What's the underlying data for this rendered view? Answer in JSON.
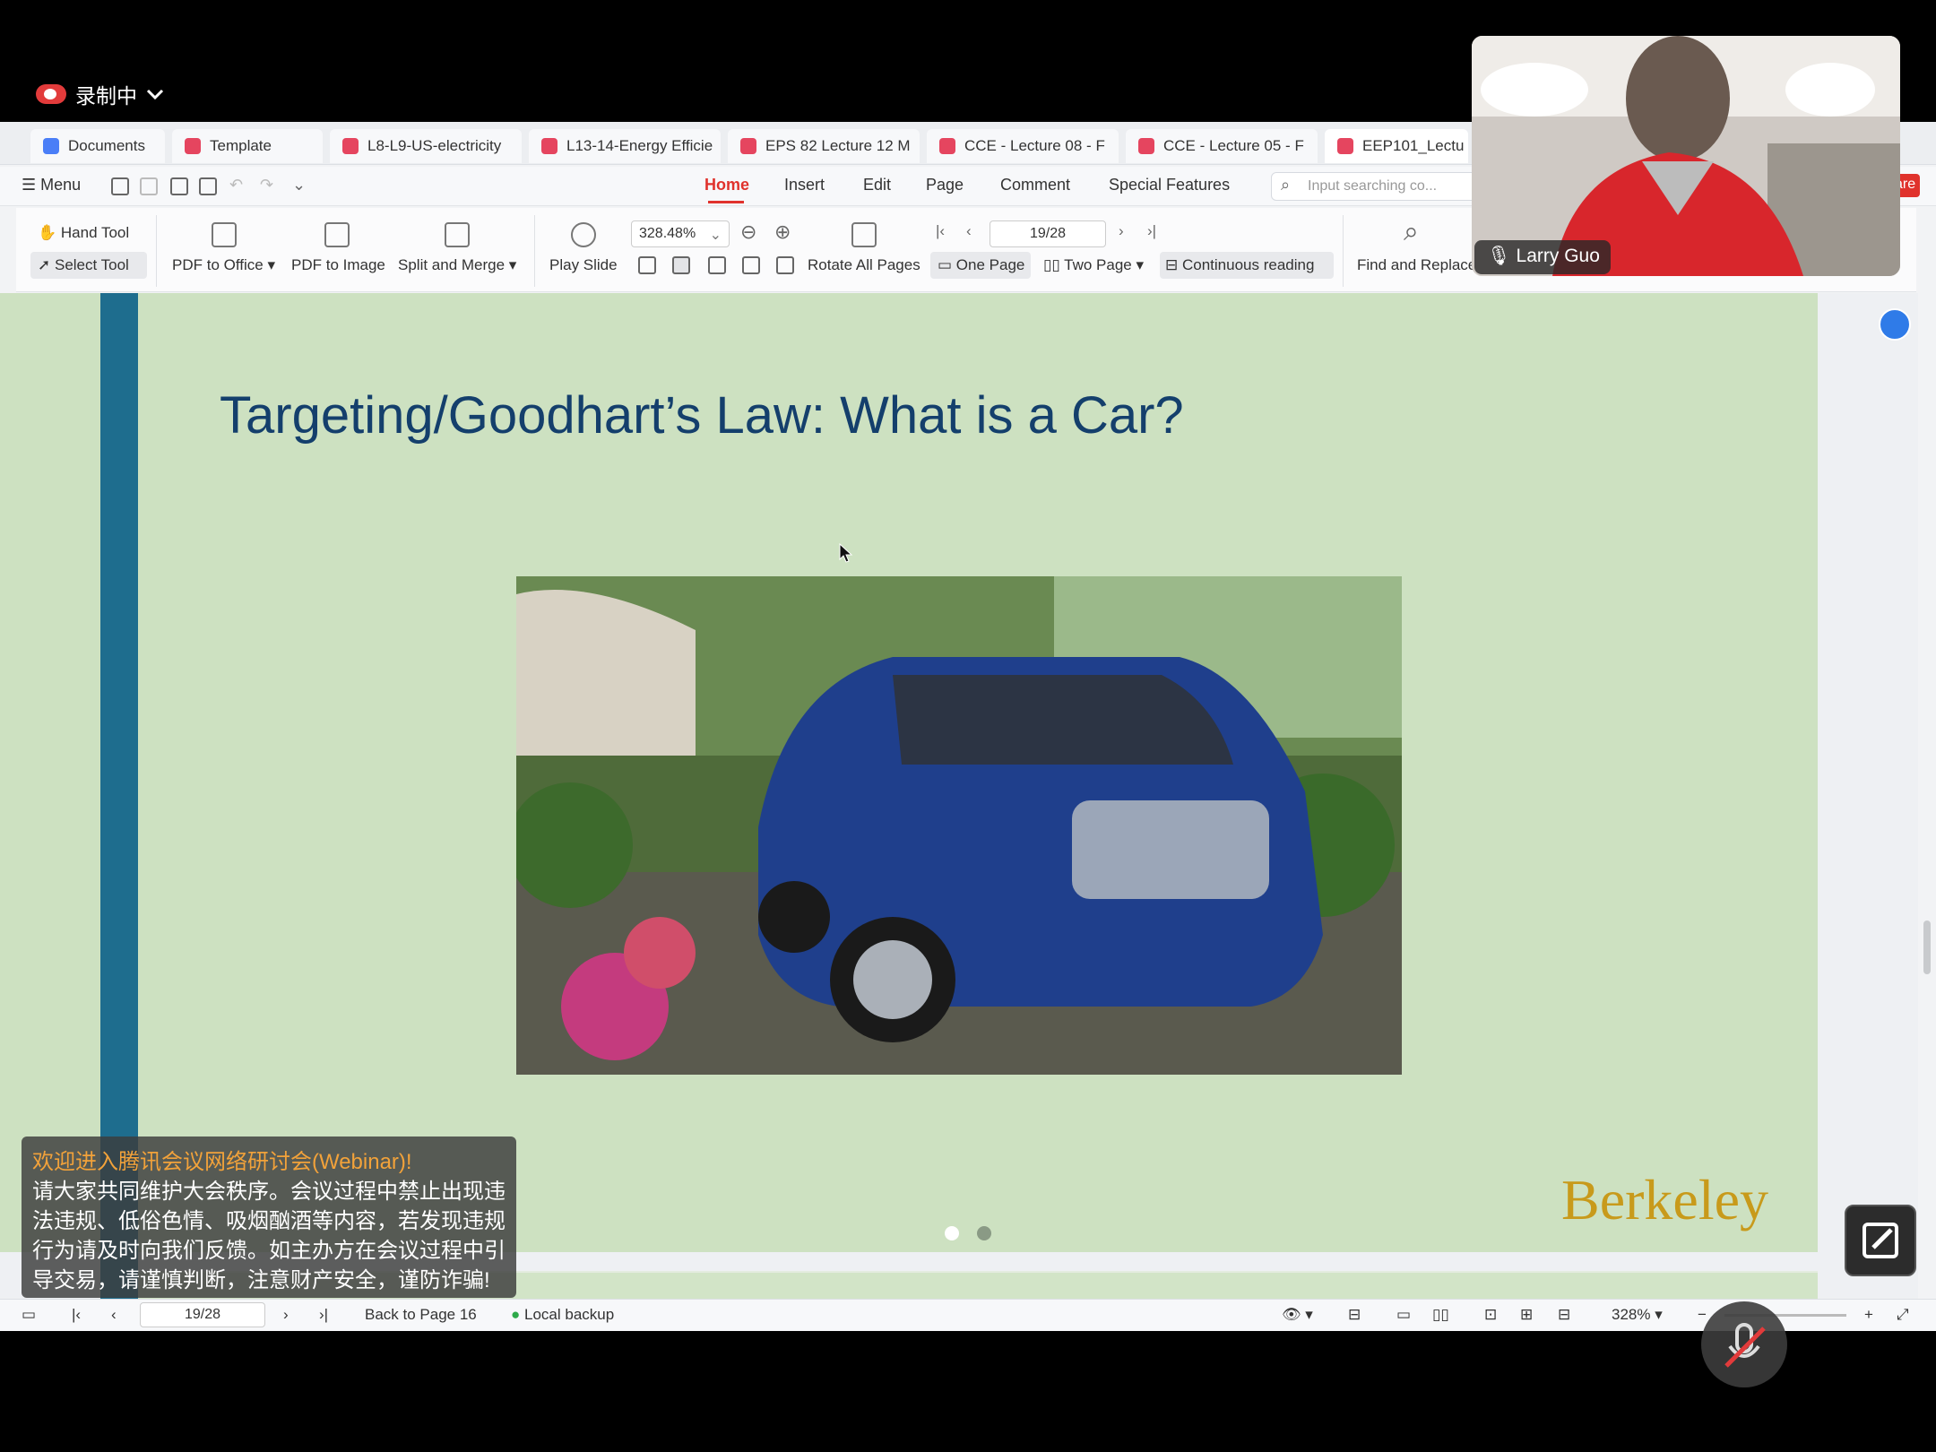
{
  "recording": {
    "label": "录制中"
  },
  "tabs": [
    {
      "label": "Documents"
    },
    {
      "label": "Template"
    },
    {
      "label": "L8-L9-US-electricity"
    },
    {
      "label": "L13-14-Energy Efficie"
    },
    {
      "label": "EPS 82 Lecture 12 M"
    },
    {
      "label": "CCE - Lecture 08 - F"
    },
    {
      "label": "CCE - Lecture 05 - F"
    },
    {
      "label": "EEP101_Lectu"
    }
  ],
  "menubar": {
    "menu": "Menu",
    "items": [
      "Home",
      "Insert",
      "Edit",
      "Page",
      "Comment",
      "Special Features"
    ],
    "search_placeholder": "Input searching co...",
    "share_fragment": "are"
  },
  "ribbon": {
    "hand_tool": "Hand Tool",
    "select_tool": "Select Tool",
    "pdf_to_office": "PDF to Office",
    "pdf_to_image": "PDF to Image",
    "split_merge": "Split and Merge",
    "play_slide": "Play Slide",
    "zoom": "328.48%",
    "rotate_all": "Rotate All Pages",
    "page_field": "19/28",
    "one_page": "One Page",
    "two_page": "Two Page",
    "continuous": "Continuous reading",
    "find_replace": "Find and Replace"
  },
  "slide": {
    "title": "Targeting/Goodhart’s Law: What is a Car?",
    "logo": "Berkeley"
  },
  "statusbar": {
    "page": "19/28",
    "back": "Back to Page 16",
    "backup": "Local backup",
    "zoom": "328%"
  },
  "notice": {
    "line1": "欢迎进入腾讯会议网络研讨会(Webinar)!",
    "body": "请大家共同维护大会秩序。会议过程中禁止出现违法违规、低俗色情、吸烟酗酒等内容，若发现违规行为请及时向我们反馈。如主办方在会议过程中引导交易，请谨慎判断，注意财产安全，谨防诈骗!"
  },
  "video": {
    "name": "Larry Guo"
  },
  "colors": {
    "accent": "#e0322c",
    "slide_bg": "#cde1c1",
    "stripe": "#1e6d8e",
    "title": "#143f6c",
    "berkeley": "#c89a1b"
  }
}
